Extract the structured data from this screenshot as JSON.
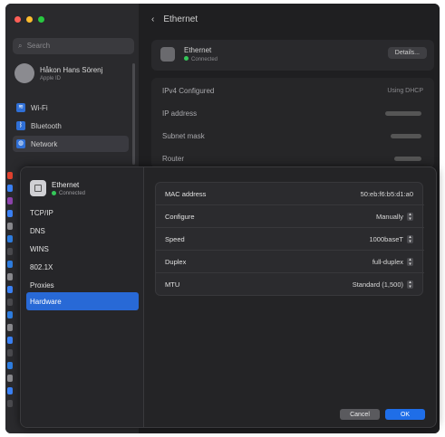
{
  "window": {
    "traffic_lights": [
      "#ff5f57",
      "#febc2e",
      "#28c840"
    ]
  },
  "sidebar": {
    "search_placeholder": "Search",
    "account": {
      "name": "Håkon Hans Sörenj",
      "subtitle": "Apple ID"
    },
    "items": [
      {
        "label": "Wi-Fi",
        "icon": "wifi-icon"
      },
      {
        "label": "Bluetooth",
        "icon": "bluetooth-icon"
      },
      {
        "label": "Network",
        "icon": "globe-icon"
      }
    ],
    "strip_colors": [
      "#e0412e",
      "#3b82f6",
      "#8e44ad",
      "#3b82f6",
      "#8a8a8e",
      "#2e7de0",
      "#4a4a4e",
      "#2e7de0",
      "#8a8a8e",
      "#3b82f6",
      "#4a4a4e",
      "#2e7de0",
      "#8a8a8e",
      "#3b82f6",
      "#4a4a4e",
      "#2e7de0",
      "#8a8a8e",
      "#3b82f6",
      "#4a4a4e"
    ]
  },
  "background": {
    "back_icon": "chevron-left-icon",
    "title": "Ethernet",
    "card": {
      "name": "Ethernet",
      "status": "Connected",
      "details_label": "Details..."
    },
    "rows": [
      {
        "label": "IPv4 Configured",
        "value": "Using DHCP"
      },
      {
        "label": "IP address",
        "value": ""
      },
      {
        "label": "Subnet mask",
        "value": ""
      },
      {
        "label": "Router",
        "value": ""
      }
    ]
  },
  "sheet": {
    "header": {
      "title": "Ethernet",
      "status": "Connected"
    },
    "nav": [
      {
        "label": "TCP/IP"
      },
      {
        "label": "DNS"
      },
      {
        "label": "WINS"
      },
      {
        "label": "802.1X"
      },
      {
        "label": "Proxies"
      },
      {
        "label": "Hardware",
        "active": true
      }
    ],
    "hardware": {
      "mac_label": "MAC address",
      "mac_value": "50:eb:f6:b5:d1:a0",
      "configure_label": "Configure",
      "configure_value": "Manually",
      "speed_label": "Speed",
      "speed_value": "1000baseT",
      "duplex_label": "Duplex",
      "duplex_value": "full-duplex",
      "mtu_label": "MTU",
      "mtu_value": "Standard (1,500)"
    },
    "buttons": {
      "cancel": "Cancel",
      "ok": "OK"
    }
  }
}
